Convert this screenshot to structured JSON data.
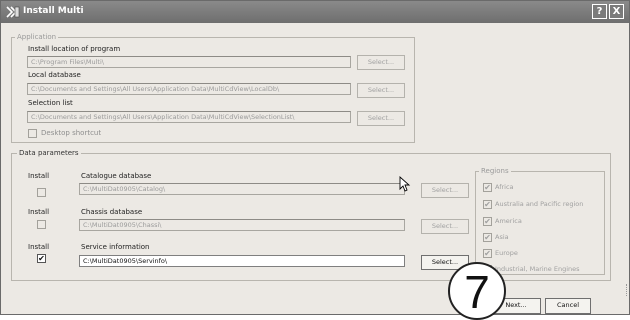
{
  "window": {
    "title": "Install Multi",
    "help_glyph": "?",
    "close_glyph": "X"
  },
  "application": {
    "legend": "Application",
    "install_location_label": "Install location of program",
    "install_location_value": "C:\\Program Files\\Multi\\",
    "local_db_label": "Local database",
    "local_db_value": "C:\\Documents and Settings\\All Users\\Application Data\\MultiCdView\\LocalDb\\",
    "selection_list_label": "Selection list",
    "selection_list_value": "C:\\Documents and Settings\\All Users\\Application Data\\MultiCdView\\SelectionList\\",
    "desktop_shortcut_label": "Desktop shortcut",
    "select_label": "Select..."
  },
  "data_parameters": {
    "legend": "Data parameters",
    "install_label": "Install",
    "select_label": "Select...",
    "rows": [
      {
        "name": "Catalogue database",
        "path": "C:\\MultiDat0905\\Catalog\\",
        "checked": false
      },
      {
        "name": "Chassis database",
        "path": "C:\\MultiDat0905\\Chassi\\",
        "checked": false
      },
      {
        "name": "Service information",
        "path": "C:\\MultiDat0905\\Servinfo\\",
        "checked": true,
        "check_glyph": "✔"
      }
    ]
  },
  "regions": {
    "legend": "Regions",
    "check_glyph": "✔",
    "items": [
      "Africa",
      "Australia and Pacific region",
      "America",
      "Asia",
      "Europe",
      "Industrial, Marine Engines"
    ]
  },
  "footer": {
    "next_label": "Next...",
    "cancel_label": "Cancel"
  },
  "callout": {
    "number": "7"
  },
  "colors": {
    "title_bar": "#7a7a7a",
    "dialog_bg": "#ece9e4",
    "disabled_text": "#a0a0a0"
  },
  "icons": [
    "install-app-icon",
    "help-icon",
    "close-icon",
    "mouse-cursor-icon",
    "checkmark-icon"
  ]
}
